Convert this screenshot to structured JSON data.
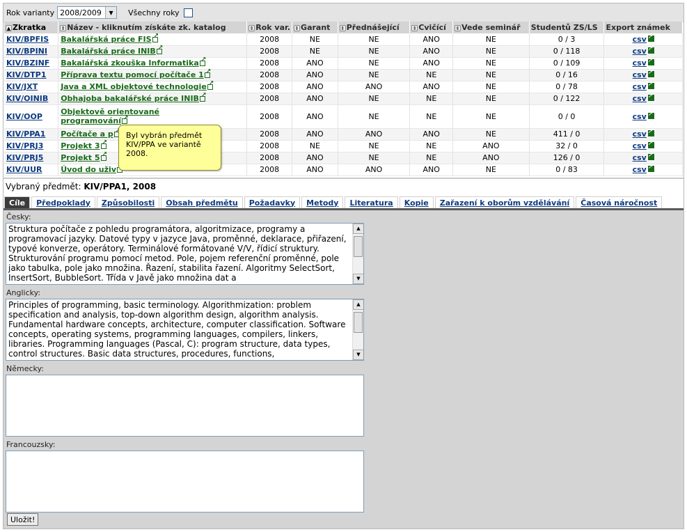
{
  "filter": {
    "year_label": "Rok varianty",
    "year_value": "2008/2009",
    "all_years_label": "Všechny roky"
  },
  "table": {
    "headers": [
      "Zkratka",
      "Název - kliknutím získáte zk. katalog",
      "Rok var.",
      "Garant",
      "Přednášející",
      "Cvičící",
      "Vede seminář",
      "Studentů ZS/LS",
      "Export známek"
    ],
    "rows": [
      {
        "code": "KIV/BPFIS",
        "name": "Bakalářská práce FIS",
        "name2": "",
        "year": "2008",
        "garant": "NE",
        "lecturer": "NE",
        "exercise": "ANO",
        "seminar": "NE",
        "students": "0 / 3",
        "export": "csv"
      },
      {
        "code": "KIV/BPINI",
        "name": "Bakalářská práce INIB",
        "name2": "",
        "year": "2008",
        "garant": "NE",
        "lecturer": "NE",
        "exercise": "ANO",
        "seminar": "NE",
        "students": "0 / 118",
        "export": "csv"
      },
      {
        "code": "KIV/BZINF",
        "name": "Bakalářská zkouška Informatika",
        "name2": "",
        "year": "2008",
        "garant": "ANO",
        "lecturer": "NE",
        "exercise": "ANO",
        "seminar": "NE",
        "students": "0 / 109",
        "export": "csv"
      },
      {
        "code": "KIV/DTP1",
        "name": "Příprava textu pomocí počítače 1",
        "name2": "",
        "year": "2008",
        "garant": "ANO",
        "lecturer": "NE",
        "exercise": "NE",
        "seminar": "NE",
        "students": "0 / 16",
        "export": "csv"
      },
      {
        "code": "KIV/JXT",
        "name": "Java a XML objektové technologie",
        "name2": "",
        "year": "2008",
        "garant": "ANO",
        "lecturer": "ANO",
        "exercise": "ANO",
        "seminar": "NE",
        "students": "0 / 78",
        "export": "csv"
      },
      {
        "code": "KIV/OINIB",
        "name": "Obhajoba bakalářské práce INIB",
        "name2": "",
        "year": "2008",
        "garant": "ANO",
        "lecturer": "NE",
        "exercise": "NE",
        "seminar": "NE",
        "students": "0 / 122",
        "export": "csv"
      },
      {
        "code": "KIV/OOP",
        "name": "Objektově orientované",
        "name2": "programování",
        "year": "2008",
        "garant": "ANO",
        "lecturer": "NE",
        "exercise": "NE",
        "seminar": "NE",
        "students": "0 / 0",
        "export": "csv"
      },
      {
        "code": "KIV/PPA1",
        "name": "Počítače a p",
        "name2": "",
        "year": "2008",
        "garant": "ANO",
        "lecturer": "ANO",
        "exercise": "ANO",
        "seminar": "NE",
        "students": "411 / 0",
        "export": "csv"
      },
      {
        "code": "KIV/PRJ3",
        "name": "Projekt 3",
        "name2": "",
        "year": "2008",
        "garant": "NE",
        "lecturer": "NE",
        "exercise": "NE",
        "seminar": "ANO",
        "students": "32 / 0",
        "export": "csv"
      },
      {
        "code": "KIV/PRJ5",
        "name": "Projekt 5",
        "name2": "",
        "year": "2008",
        "garant": "ANO",
        "lecturer": "NE",
        "exercise": "NE",
        "seminar": "ANO",
        "students": "126 / 0",
        "export": "csv"
      },
      {
        "code": "KIV/UUR",
        "name": "Úvod do uživ",
        "name2": "",
        "year": "2008",
        "garant": "ANO",
        "lecturer": "ANO",
        "exercise": "ANO",
        "seminar": "NE",
        "students": "0 / 83",
        "export": "csv"
      }
    ]
  },
  "tooltip": {
    "lines": [
      "Byl vybrán předmět",
      "KIV/PPA ve variantě",
      "2008."
    ]
  },
  "selected": {
    "label": "Vybraný předmět:",
    "value": "KIV/PPA1, 2008"
  },
  "tabs": [
    "Cíle",
    "Předpoklady",
    "Způsobilosti",
    "Obsah předmětu",
    "Požadavky",
    "Metody",
    "Literatura",
    "Kopie",
    "Zařazení k oborům vzdělávání",
    "Časová náročnost"
  ],
  "form": {
    "czech_label": "Česky:",
    "czech_text": "Struktura počítače z pohledu programátora, algoritmizace, programy a programovací jazyky. Datové typy v jazyce Java, proměnné, deklarace, přiřazení, typové konverze, operátory. Terminálové formátované V/V, řídicí struktury. Strukturování programu pomocí metod. Pole, pojem referenční proměnné, pole jako tabulka, pole jako množina. Řazení, stabilita řazení. Algoritmy SelectSort, InsertSort, BubbleSort. Třída v Javě jako množina dat a",
    "english_label": "Anglicky:",
    "english_text": "Principles of programming, basic terminology. Algorithmization: problem specification and analysis,  top-down algorithm design, algorithm analysis. Fundamental  hardware concepts, architecture, computer classification. Software concepts, operating systems, programming languages, compilers, linkers, libraries. Programming  languages (Pascal, C): program structure, data types, control structures. Basic data structures, procedures,   functions,",
    "german_label": "Německy:",
    "german_text": "",
    "french_label": "Francouzsky:",
    "french_text": "",
    "save_label": "Uložit!"
  }
}
